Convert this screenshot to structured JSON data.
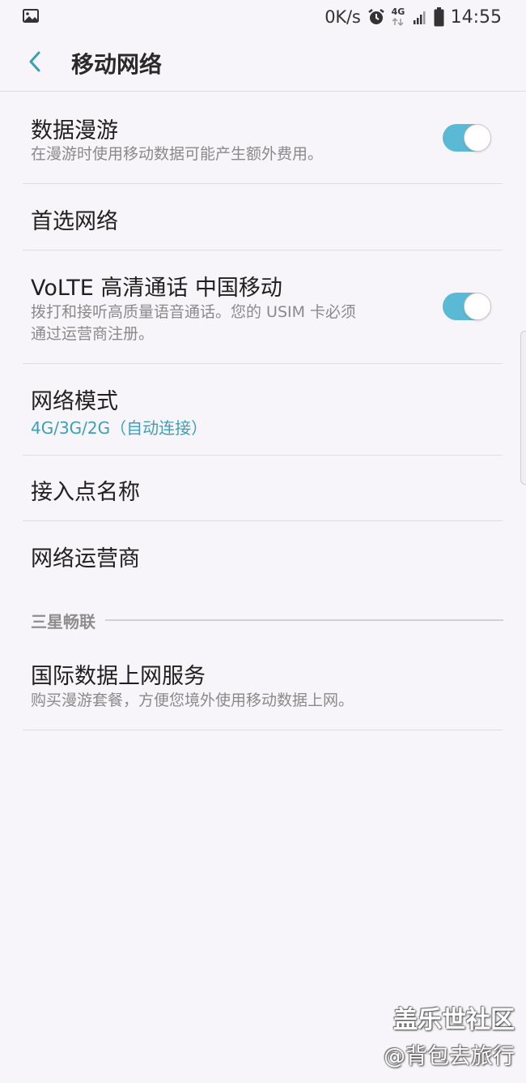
{
  "status_bar": {
    "left_icon": "image-icon",
    "net_speed": "0K/s",
    "network_type": "4G",
    "time": "14:55",
    "icons": [
      "alarm-icon",
      "signal-icon",
      "battery-icon"
    ]
  },
  "header": {
    "back_icon": "chevron-left-icon",
    "title": "移动网络"
  },
  "settings": {
    "data_roaming": {
      "title": "数据漫游",
      "description": "在漫游时使用移动数据可能产生额外费用。",
      "enabled": true
    },
    "preferred_network": {
      "title": "首选网络"
    },
    "volte": {
      "title": "VoLTE 高清通话 中国移动",
      "description_line1": "拨打和接听高质量语音通话。您的 USIM 卡必须",
      "description_line2": "通过运营商注册。",
      "enabled": true
    },
    "network_mode": {
      "title": "网络模式",
      "value": "4G/3G/2G（自动连接）"
    },
    "apn": {
      "title": "接入点名称"
    },
    "operators": {
      "title": "网络运营商"
    },
    "section_samsung": {
      "label": "三星畅联"
    },
    "intl_data": {
      "title": "国际数据上网服务",
      "description": "购买漫游套餐，方便您境外使用移动数据上网。"
    }
  },
  "watermark": {
    "forum": "盖乐世社区",
    "user": "@背包去旅行"
  },
  "colors": {
    "background": "#f7f5f9",
    "accent": "#5ab9d4",
    "value_text": "#3aa0b8",
    "secondary_text": "#8a8a8a"
  }
}
